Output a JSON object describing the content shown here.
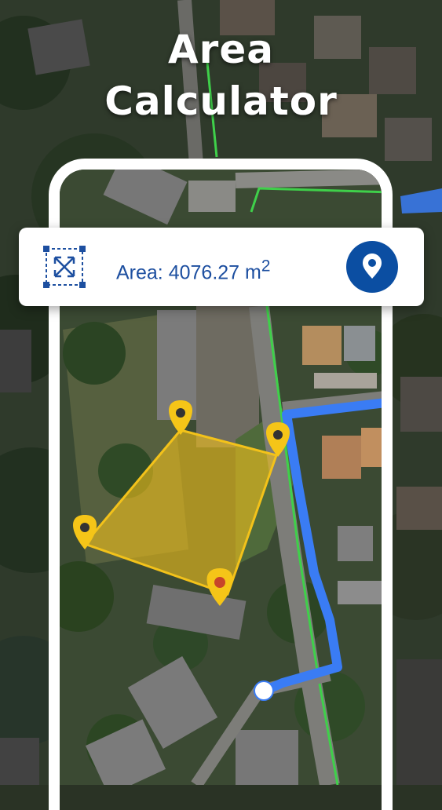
{
  "headline": {
    "line1": "Area",
    "line2": "Calculator"
  },
  "area_card": {
    "label": "Area:",
    "value": "4076.27",
    "unit": "m",
    "unit_power": "2",
    "expand_icon": "expand-area-icon",
    "location_icon": "location-pin-icon"
  },
  "colors": {
    "accent_blue": "#0b4ea2",
    "area_text": "#1d4fa0",
    "polygon_fill": "#f3c21a",
    "route_blue": "#3a7cf4",
    "pin_yellow": "#f5c518"
  }
}
